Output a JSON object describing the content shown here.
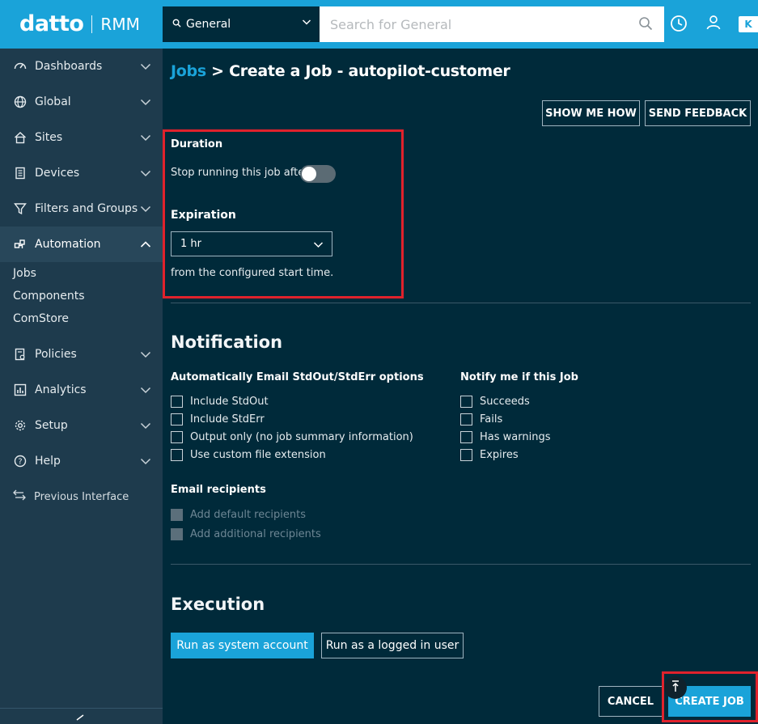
{
  "header": {
    "brand": "datto",
    "product": "RMM",
    "search_scope": "General",
    "search_placeholder": "Search for General",
    "kaseya_badge": "K"
  },
  "sidebar": {
    "items": [
      {
        "label": "Dashboards",
        "icon": "dashboard-icon"
      },
      {
        "label": "Global",
        "icon": "globe-icon"
      },
      {
        "label": "Sites",
        "icon": "home-icon"
      },
      {
        "label": "Devices",
        "icon": "device-icon"
      },
      {
        "label": "Filters and Groups",
        "icon": "filter-icon"
      },
      {
        "label": "Automation",
        "icon": "automation-icon"
      }
    ],
    "automation_sub": [
      "Jobs",
      "Components",
      "ComStore"
    ],
    "items_after": [
      {
        "label": "Policies",
        "icon": "policy-icon"
      },
      {
        "label": "Analytics",
        "icon": "analytics-icon"
      },
      {
        "label": "Setup",
        "icon": "gear-icon"
      },
      {
        "label": "Help",
        "icon": "help-icon"
      }
    ],
    "previous_interface": "Previous Interface"
  },
  "main": {
    "breadcrumb_link": "Jobs",
    "breadcrumb_rest": " > Create a Job - autopilot-customer",
    "show_me_how": "SHOW ME HOW",
    "send_feedback": "SEND FEEDBACK",
    "duration_label": "Duration",
    "stop_running_label": "Stop running this job after",
    "stop_running_enabled": false,
    "expiration_label": "Expiration",
    "expiration_value": "1 hr",
    "expiration_note": "from the configured start time.",
    "notification_title": "Notification",
    "email_options_title": "Automatically Email StdOut/StdErr options",
    "email_options": [
      "Include StdOut",
      "Include StdErr",
      "Output only (no job summary information)",
      "Use custom file extension"
    ],
    "notify_title": "Notify me if this Job",
    "notify_options": [
      "Succeeds",
      "Fails",
      "Has warnings",
      "Expires"
    ],
    "recipients_title": "Email recipients",
    "recipient_options": [
      "Add default recipients",
      "Add additional recipients"
    ],
    "execution_title": "Execution",
    "run_system": "Run as system account",
    "run_logged_in": "Run as a logged in user",
    "cancel": "CANCEL",
    "create_job": "CREATE JOB"
  },
  "colors": {
    "accent": "#1aa3d9",
    "background": "#002a3a",
    "sidebar": "#1e3b4d",
    "highlight": "#e0222c"
  }
}
